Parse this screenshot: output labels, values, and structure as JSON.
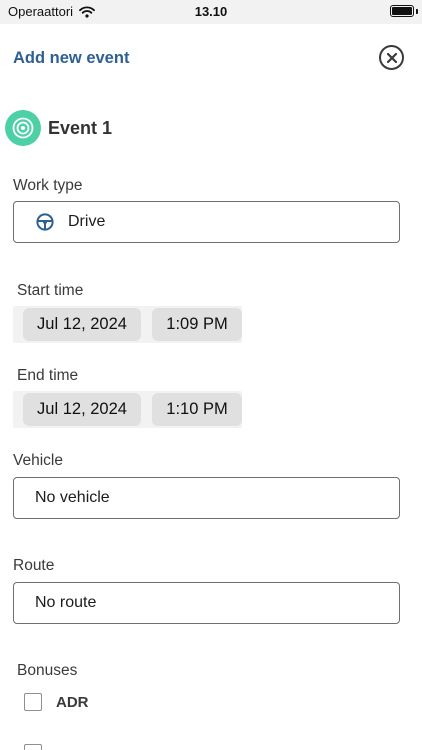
{
  "status_bar": {
    "carrier": "Operaattori",
    "time": "13.10"
  },
  "header": {
    "title": "Add new event"
  },
  "event": {
    "title": "Event 1"
  },
  "work_type": {
    "label": "Work type",
    "value": "Drive"
  },
  "start_time": {
    "label": "Start time",
    "date": "Jul 12, 2024",
    "time": "1:09 PM"
  },
  "end_time": {
    "label": "End time",
    "date": "Jul 12, 2024",
    "time": "1:10 PM"
  },
  "vehicle": {
    "label": "Vehicle",
    "value": "No vehicle"
  },
  "route": {
    "label": "Route",
    "value": "No route"
  },
  "bonuses": {
    "label": "Bonuses",
    "items": [
      {
        "label": "ADR",
        "checked": false
      }
    ]
  },
  "colors": {
    "accent": "#2e5f95",
    "event_icon": "#4dd0a6"
  }
}
